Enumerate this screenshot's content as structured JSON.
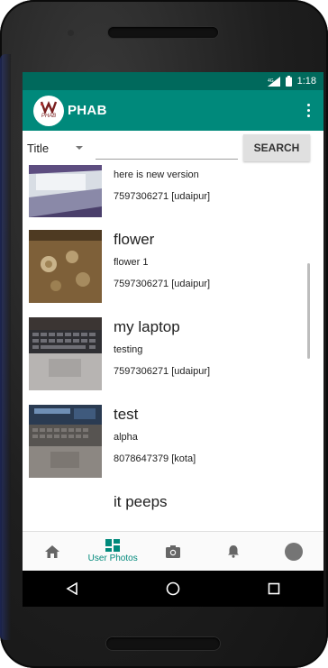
{
  "status_bar": {
    "time": "1:18",
    "network": "4G"
  },
  "app_bar": {
    "title": "PHAB",
    "logo_text": "PHAB",
    "menu_icon": "more-vert-icon"
  },
  "search": {
    "filter_selected": "Title",
    "input_value": "",
    "button_label": "SEARCH"
  },
  "posts": [
    {
      "title": "",
      "description": "here is new version",
      "contact": "7597306271 [udaipur]"
    },
    {
      "title": "flower",
      "description": "flower 1",
      "contact": "7597306271 [udaipur]"
    },
    {
      "title": "my laptop",
      "description": "testing",
      "contact": "7597306271 [udaipur]"
    },
    {
      "title": "test",
      "description": "alpha",
      "contact": "8078647379 [kota]"
    },
    {
      "title": "it peeps",
      "description": "",
      "contact": ""
    }
  ],
  "bottom_nav": {
    "items": [
      {
        "icon": "home-icon",
        "label": ""
      },
      {
        "icon": "grid-icon",
        "label": "User Photos"
      },
      {
        "icon": "camera-icon",
        "label": ""
      },
      {
        "icon": "bell-icon",
        "label": ""
      },
      {
        "icon": "avatar-icon",
        "label": ""
      }
    ],
    "active_index": 1
  },
  "colors": {
    "primary": "#00897b",
    "primary_dark": "#00695c",
    "accent": "#00897b"
  }
}
